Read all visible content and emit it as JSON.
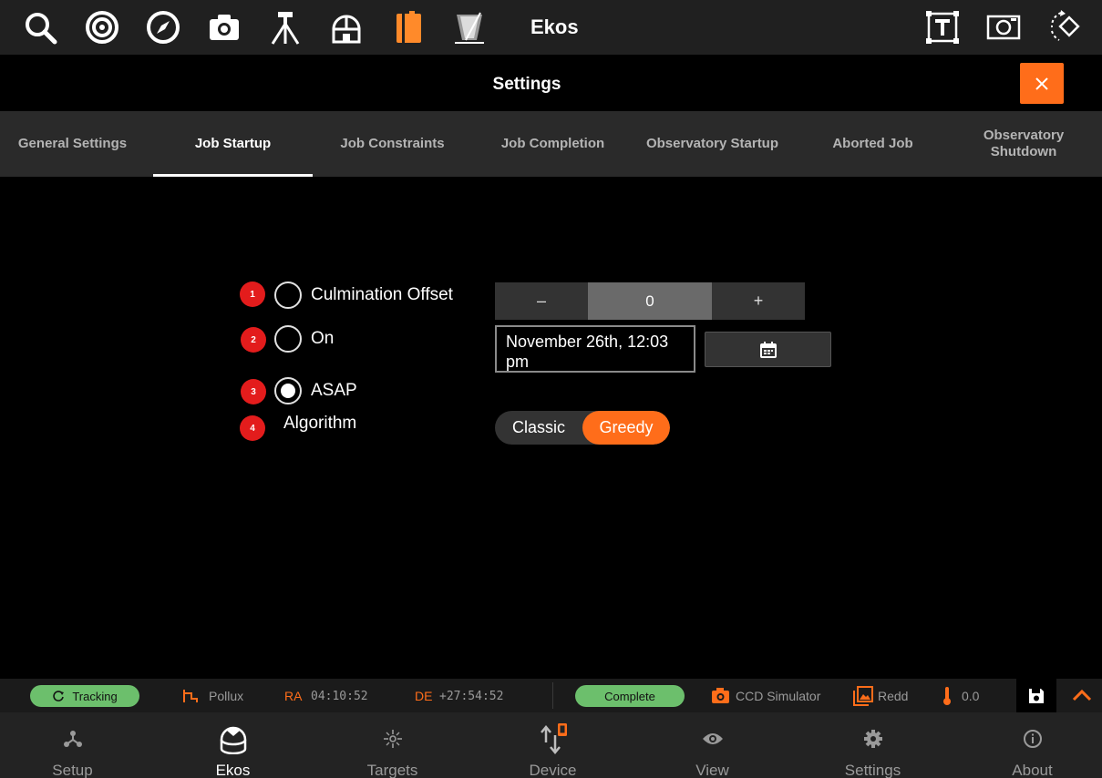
{
  "app": {
    "title": "Ekos"
  },
  "settings": {
    "title": "Settings"
  },
  "tabs": [
    {
      "label": "General Settings"
    },
    {
      "label": "Job Startup"
    },
    {
      "label": "Job Constraints"
    },
    {
      "label": "Job Completion"
    },
    {
      "label": "Observatory Startup"
    },
    {
      "label": "Aborted Job"
    },
    {
      "label": "Observatory Shutdown"
    }
  ],
  "startup": {
    "badges": [
      "1",
      "2",
      "3",
      "4"
    ],
    "culmination_label": "Culmination Offset",
    "on_label": "On",
    "asap_label": "ASAP",
    "algorithm_label": "Algorithm",
    "selected_option": "ASAP",
    "offset": {
      "minus": "–",
      "value": "0",
      "plus": "+"
    },
    "date_value": "November 26th, 12:03 pm",
    "algorithm": {
      "classic": "Classic",
      "greedy": "Greedy",
      "selected": "Greedy"
    }
  },
  "status": {
    "tracking": "Tracking",
    "target": "Pollux",
    "ra_label": "RA",
    "ra_value": "04:10:52",
    "de_label": "DE",
    "de_value": "+27:54:52",
    "capture_state": "Complete",
    "camera": "CCD Simulator",
    "filter": "Redd",
    "temperature": "0.0"
  },
  "nav": [
    {
      "label": "Setup"
    },
    {
      "label": "Ekos"
    },
    {
      "label": "Targets"
    },
    {
      "label": "Device"
    },
    {
      "label": "View"
    },
    {
      "label": "Settings"
    },
    {
      "label": "About"
    }
  ],
  "colors": {
    "accent": "#ff6d1a",
    "badge": "#e31c1c",
    "ok": "#6cbf6c",
    "active_tool": "#ff8a2a"
  },
  "icons": {
    "toolbar": [
      "search-icon",
      "target-icon",
      "compass-icon",
      "camera-icon",
      "tripod-icon",
      "observatory-icon",
      "scheduler-icon",
      "flat-field-icon",
      "text-frame-icon",
      "image-frame-icon",
      "rotate-icon"
    ]
  }
}
